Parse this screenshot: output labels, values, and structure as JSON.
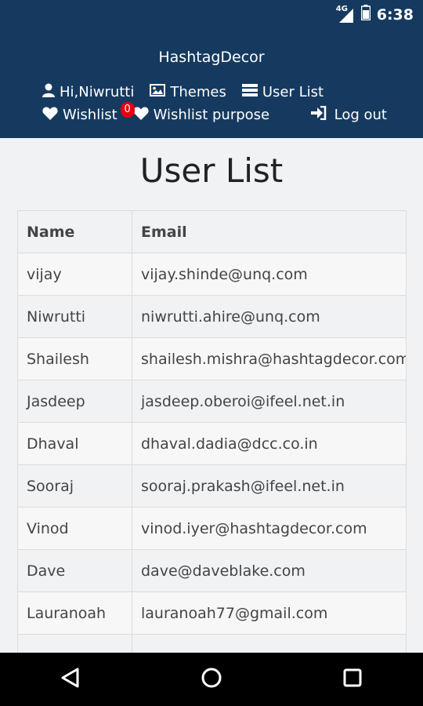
{
  "status": {
    "network": "4G",
    "time": "6:38"
  },
  "header": {
    "title": "HashtagDecor",
    "nav": {
      "greeting": "Hi,Niwrutti",
      "themes": "Themes",
      "user_list": "User List",
      "wishlist": "Wishlist",
      "wishlist_count": "0",
      "wishlist_purpose": "Wishlist purpose",
      "logout": "Log out"
    }
  },
  "page": {
    "title": "User List"
  },
  "table": {
    "headers": [
      "Name",
      "Email"
    ],
    "rows": [
      [
        "vijay",
        "vijay.shinde@unq.com"
      ],
      [
        "Niwrutti",
        "niwrutti.ahire@unq.com"
      ],
      [
        "Shailesh",
        "shailesh.mishra@hashtagdecor.com"
      ],
      [
        "Jasdeep",
        "jasdeep.oberoi@ifeel.net.in"
      ],
      [
        "Dhaval",
        "dhaval.dadia@dcc.co.in"
      ],
      [
        "Sooraj",
        "sooraj.prakash@ifeel.net.in"
      ],
      [
        "Vinod",
        "vinod.iyer@hashtagdecor.com"
      ],
      [
        "Dave",
        "dave@daveblake.com"
      ],
      [
        "Lauranoah",
        "lauranoah77@gmail.com"
      ],
      [
        "",
        ""
      ]
    ]
  },
  "colors": {
    "header_bg": "#163a5f",
    "badge": "#e4000f"
  }
}
